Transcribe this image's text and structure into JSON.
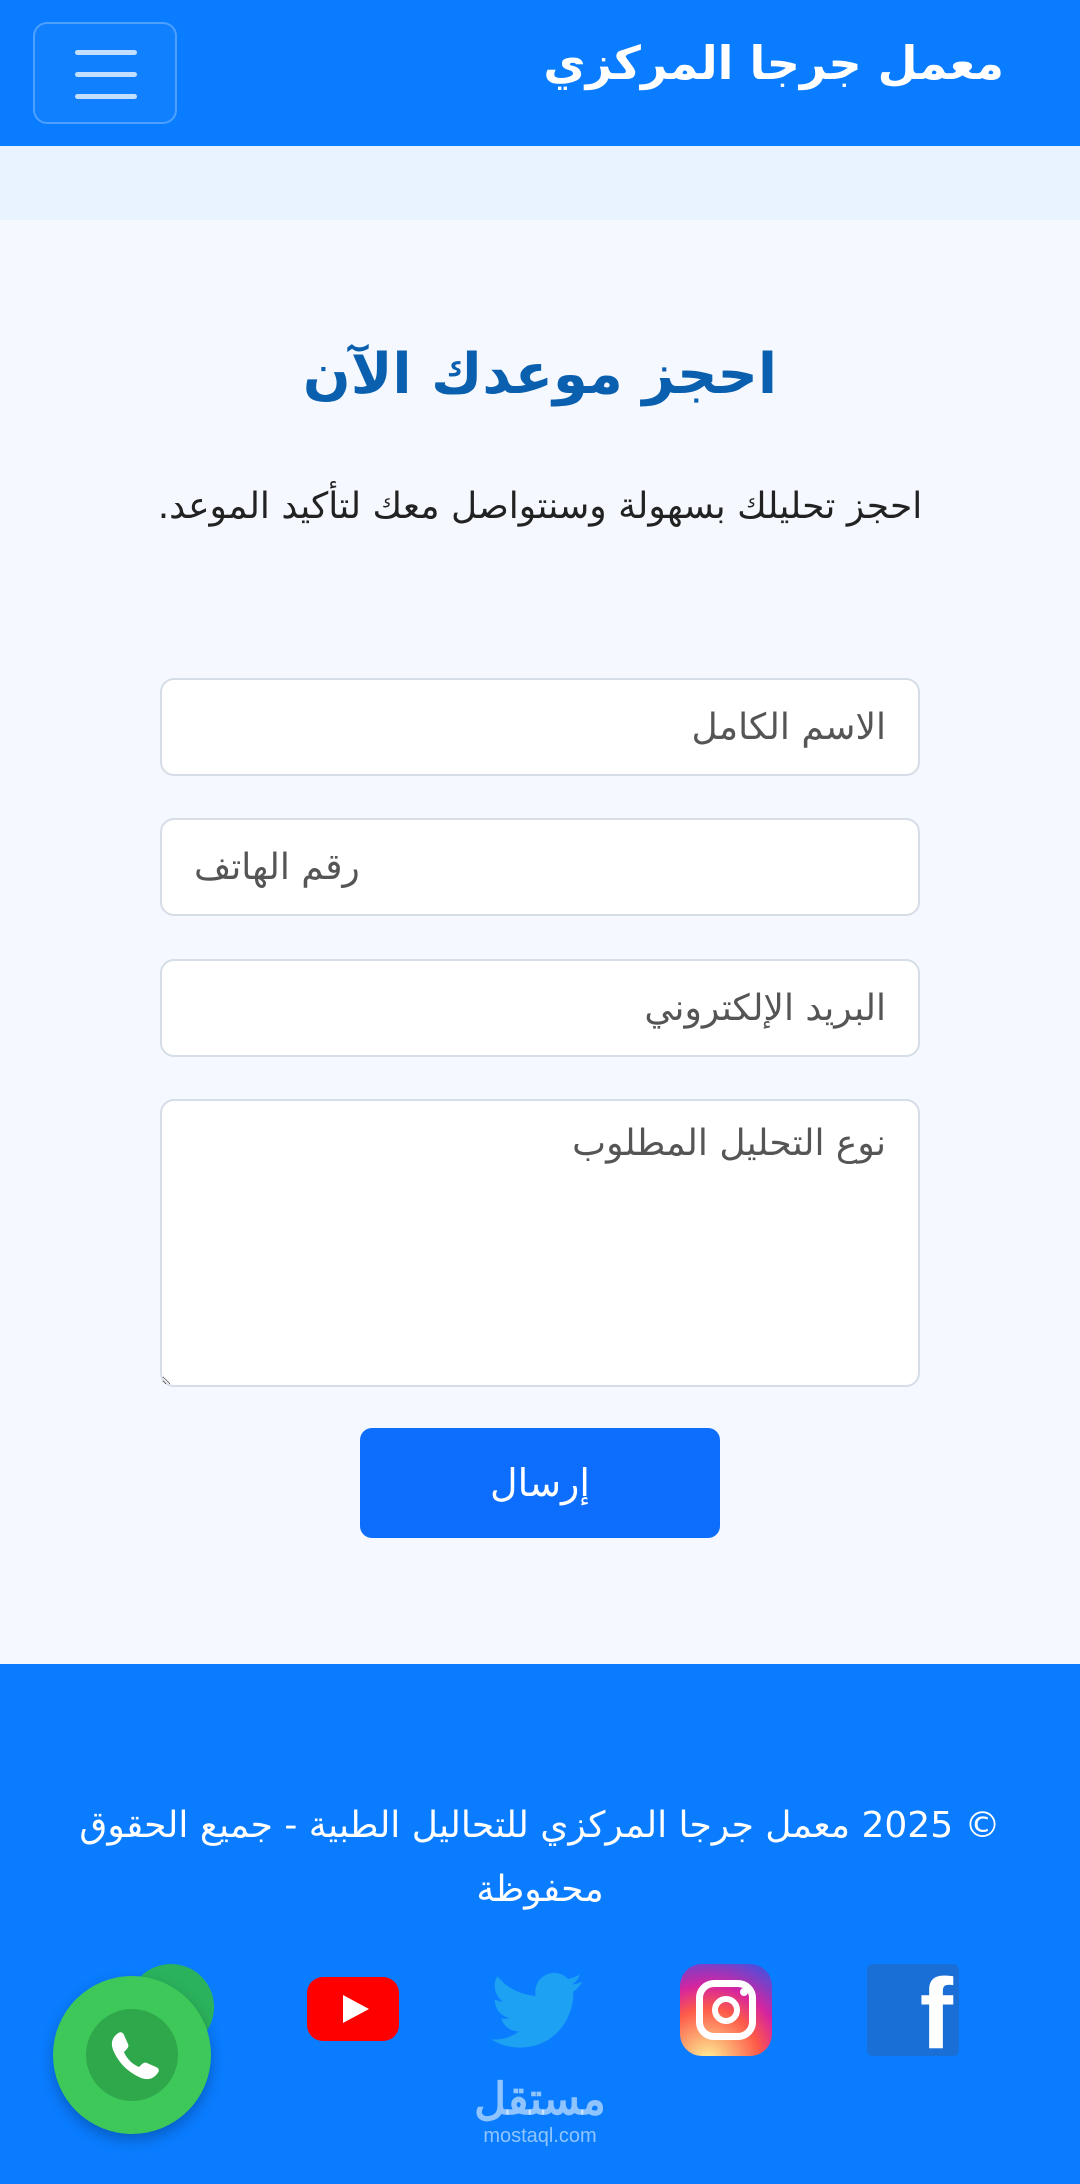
{
  "header": {
    "brand": "معمل جرجا المركزي",
    "menu_icon": "hamburger-menu-icon"
  },
  "booking": {
    "title": "احجز موعدك الآن",
    "subtitle": "احجز تحليلك بسهولة وسنتواصل معك لتأكيد الموعد.",
    "fields": {
      "name_placeholder": "الاسم الكامل",
      "phone_placeholder": "رقم الهاتف",
      "email_placeholder": "البريد الإلكتروني",
      "analysis_placeholder": "نوع التحليل المطلوب"
    },
    "submit_label": "إرسال"
  },
  "footer": {
    "copyright": "© 2025 معمل جرجا المركزي للتحاليل الطبية - جميع الحقوق محفوظة",
    "social": [
      "facebook-icon",
      "instagram-icon",
      "twitter-icon",
      "youtube-icon"
    ],
    "whatsapp_icon": "whatsapp-icon"
  },
  "watermark": {
    "ar": "مستقل",
    "en": "mostaql.com"
  },
  "colors": {
    "primary": "#0a7cff",
    "button": "#0d6efd",
    "title": "#0a5fae",
    "section_bg": "#f5f9ff",
    "whatsapp": "#3ec85a"
  }
}
